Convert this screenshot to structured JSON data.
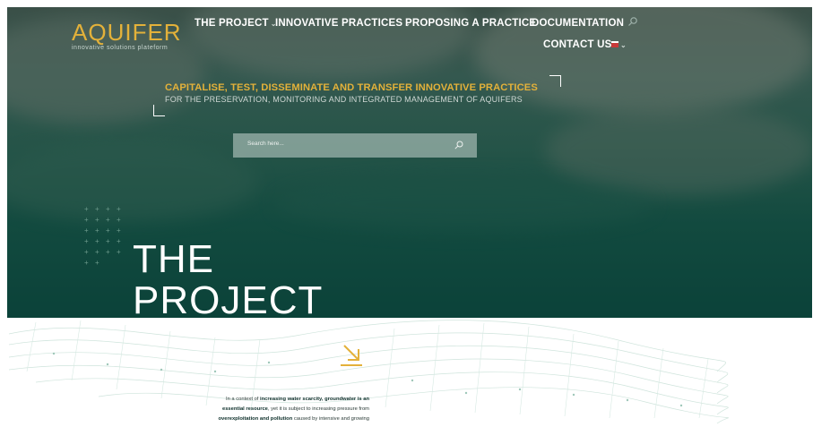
{
  "logo": {
    "name": "AQUIFER",
    "tagline": "innovative solutions plateform"
  },
  "nav": {
    "project": "THE PROJECT",
    "innovative": "INNOVATIVE PRACTICES",
    "proposing": "PROPOSING A PRACTICE",
    "documentation": "DOCUMENTATION",
    "contact": "CONTACT US"
  },
  "hero": {
    "headline": "CAPITALISE, TEST, DISSEMINATE AND TRANSFER INNOVATIVE PRACTICES",
    "subline": "FOR THE PRESERVATION, MONITORING AND INTEGRATED MANAGEMENT OF AQUIFERS",
    "search_placeholder": "Search here...",
    "section_title_1": "THE",
    "section_title_2": "PROJECT"
  },
  "body_text": {
    "p1": "In a context of ",
    "b1": "increasing water scarcity, groundwater is an",
    "b2": "essential resource",
    "p2": ", yet it is subject to increasing pressure from",
    "b3": "overexploitation and pollution",
    "p3": " caused by intensive and growing"
  },
  "colors": {
    "accent": "#e3b13a",
    "hero_dark": "#0b4239",
    "text_dark": "#0d2f2a"
  }
}
